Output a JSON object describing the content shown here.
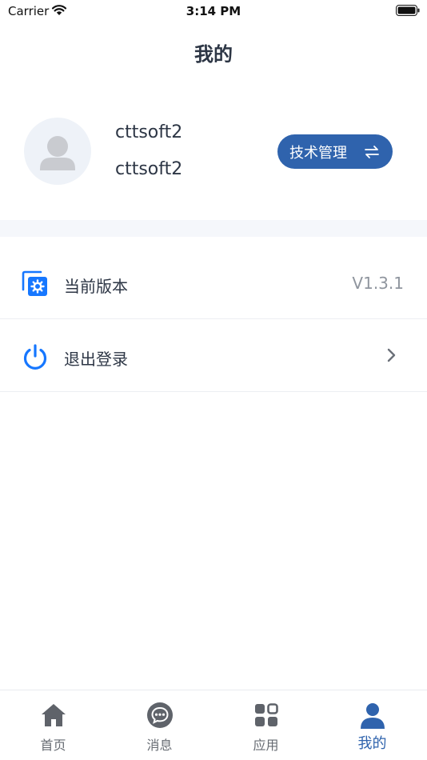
{
  "status_bar": {
    "carrier": "Carrier",
    "time": "3:14 PM"
  },
  "header": {
    "title": "我的"
  },
  "profile": {
    "name": "cttsoft2",
    "account": "cttsoft2",
    "role_button": "技术管理"
  },
  "menu": [
    {
      "label": "当前版本",
      "value": "V1.3.1",
      "icon": "version-icon"
    },
    {
      "label": "退出登录",
      "icon": "power-icon"
    }
  ],
  "tab_bar": {
    "tabs": [
      {
        "label": "首页",
        "icon": "home-icon"
      },
      {
        "label": "消息",
        "icon": "chat-icon"
      },
      {
        "label": "应用",
        "icon": "apps-icon"
      },
      {
        "label": "我的",
        "icon": "user-icon",
        "active": true
      }
    ]
  },
  "colors": {
    "accent": "#2f63ad",
    "icon_blue": "#1677ff",
    "tab_gray": "#666b72"
  }
}
